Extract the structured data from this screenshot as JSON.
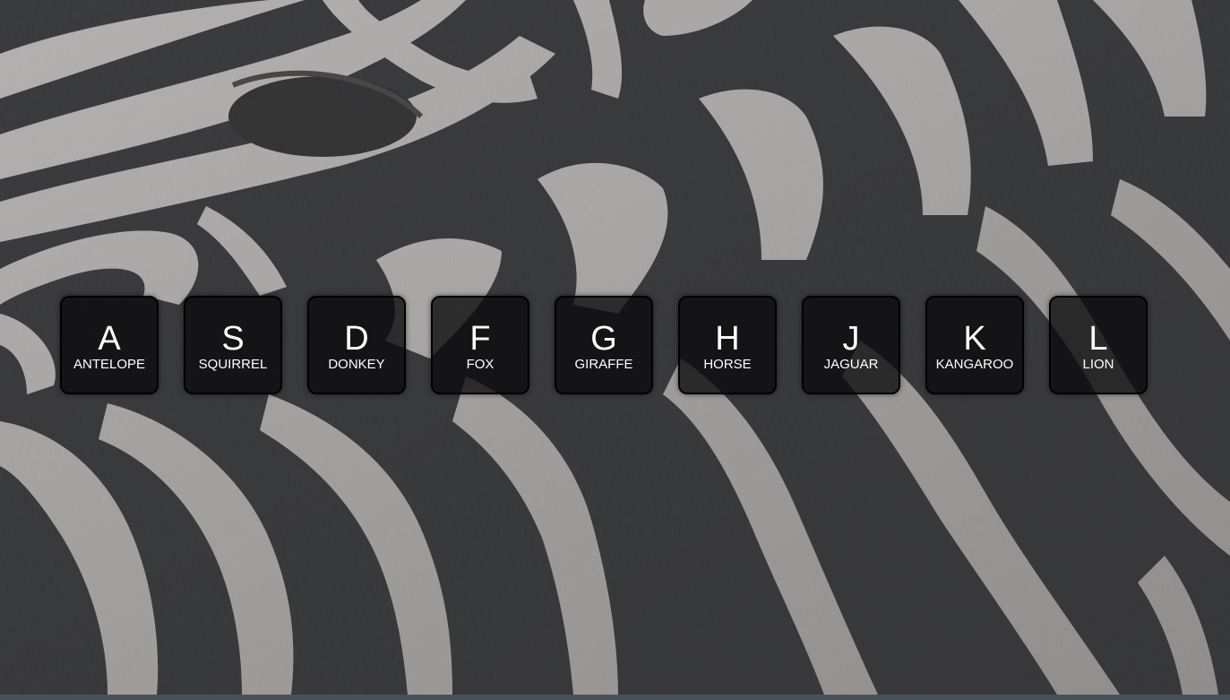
{
  "keys": [
    {
      "letter": "A",
      "label": "ANTELOPE"
    },
    {
      "letter": "S",
      "label": "SQUIRREL"
    },
    {
      "letter": "D",
      "label": "DONKEY"
    },
    {
      "letter": "F",
      "label": "FOX"
    },
    {
      "letter": "G",
      "label": "GIRAFFE"
    },
    {
      "letter": "H",
      "label": "HORSE"
    },
    {
      "letter": "J",
      "label": "JAGUAR"
    },
    {
      "letter": "K",
      "label": "KANGAROO"
    },
    {
      "letter": "L",
      "label": "LION"
    }
  ],
  "colors": {
    "key_background": "#0a0a0c",
    "key_text": "#ffffff",
    "bottom_strip": "#47525a"
  },
  "background": {
    "subject": "zebra-stripes-photo"
  }
}
